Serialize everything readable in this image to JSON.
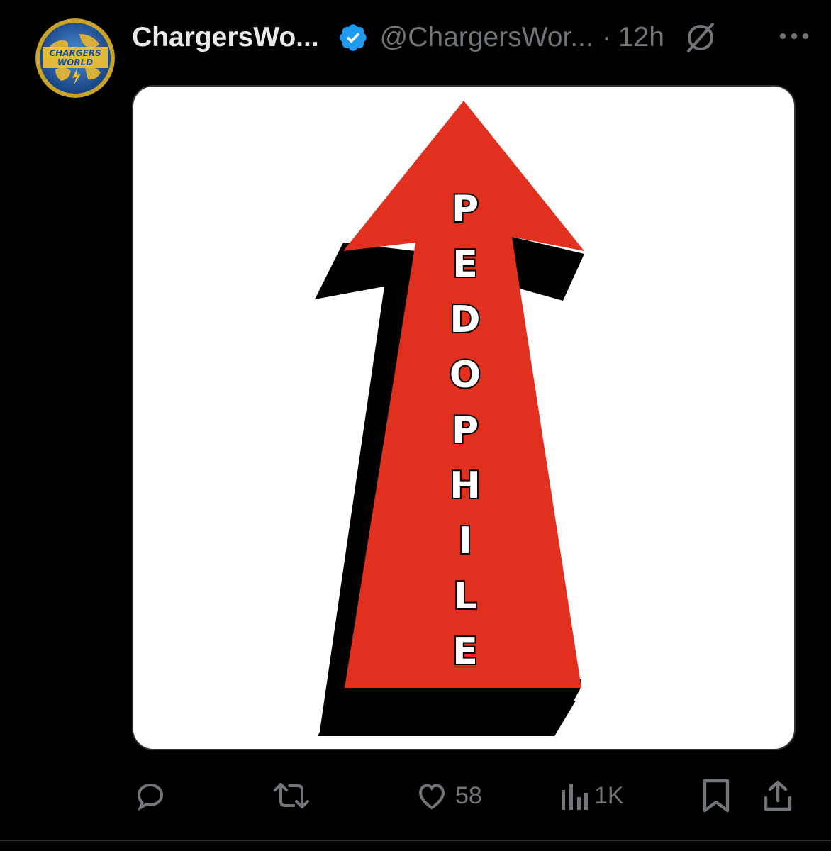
{
  "tweet": {
    "author": {
      "display_name": "ChargersWo...",
      "handle": "@ChargersWor...",
      "verified": true,
      "avatar_text_line1": "CHARGERS",
      "avatar_text_line2": "WORLD"
    },
    "separator": "·",
    "timestamp": "12h",
    "media": {
      "image_letters": [
        "P",
        "E",
        "D",
        "O",
        "P",
        "H",
        "I",
        "L",
        "E"
      ],
      "arrow_color": "#e2301f",
      "shadow_color": "#000000",
      "background": "#ffffff"
    }
  },
  "actions": {
    "reply_icon": "reply-icon",
    "retweet_icon": "retweet-icon",
    "like_icon": "heart-icon",
    "like_count": "58",
    "views_icon": "bar-chart-icon",
    "views_count": "1K",
    "bookmark_icon": "bookmark-icon",
    "share_icon": "share-icon"
  },
  "colors": {
    "background": "#000000",
    "text_primary": "#e7e9ea",
    "text_secondary": "#71767b",
    "verified_blue": "#1d9bf0",
    "border": "#2f3336"
  }
}
